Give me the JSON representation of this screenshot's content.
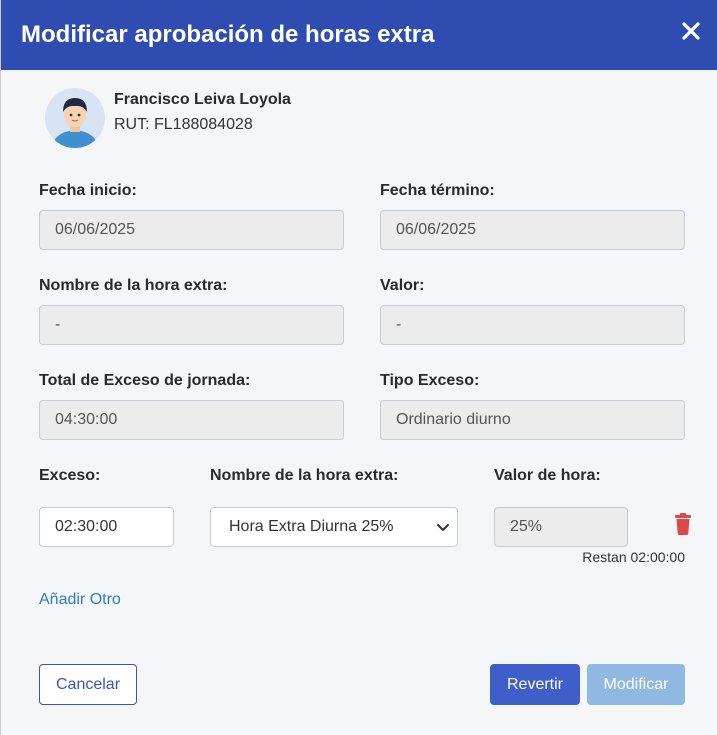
{
  "modal": {
    "title": "Modificar aprobación de horas extra",
    "close_icon": "close-icon"
  },
  "employee": {
    "name": "Francisco Leiva Loyola",
    "rut": "RUT: FL188084028",
    "avatar_icon": "user-avatar"
  },
  "fields": {
    "fecha_inicio": {
      "label": "Fecha inicio:",
      "value": "06/06/2025"
    },
    "fecha_termino": {
      "label": "Fecha término:",
      "value": "06/06/2025"
    },
    "nombre_hora_extra": {
      "label": "Nombre de la hora extra:",
      "value": "-"
    },
    "valor": {
      "label": "Valor:",
      "value": "-"
    },
    "total_exceso": {
      "label": "Total de Exceso de jornada:",
      "value": "04:30:00"
    },
    "tipo_exceso": {
      "label": "Tipo Exceso:",
      "value": "Ordinario diurno"
    }
  },
  "exceso_row": {
    "exceso_label": "Exceso:",
    "exceso_value": "02:30:00",
    "nombre_label": "Nombre de la hora extra:",
    "nombre_selected": "Hora Extra Diurna 25%",
    "valor_label": "Valor de hora:",
    "valor_value": "25%",
    "restan": "Restan 02:00:00",
    "delete_icon": "trash-icon"
  },
  "add_link": "Añadir Otro",
  "buttons": {
    "cancel": "Cancelar",
    "revert": "Revertir",
    "modify": "Modificar"
  },
  "colors": {
    "header": "#2f4db0",
    "link": "#2e7dc2",
    "primary": "#3e5fc9",
    "disabled": "#8fb8e2",
    "danger": "#e04848"
  }
}
